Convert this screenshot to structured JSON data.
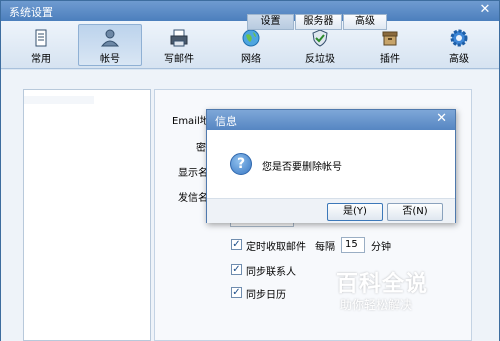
{
  "window": {
    "title": "系统设置",
    "close_glyph": "✕"
  },
  "toolbar": {
    "items": [
      {
        "label": "常用",
        "icon": "document-icon"
      },
      {
        "label": "帐号",
        "icon": "user-icon"
      },
      {
        "label": "写邮件",
        "icon": "printer-icon"
      },
      {
        "label": "网络",
        "icon": "globe-icon"
      },
      {
        "label": "反垃圾",
        "icon": "shield-icon"
      },
      {
        "label": "插件",
        "icon": "box-icon"
      },
      {
        "label": "高级",
        "icon": "gear-icon"
      }
    ],
    "active": "帐号"
  },
  "tabs": [
    "设置",
    "服务器",
    "高级"
  ],
  "form": {
    "labels": {
      "email": "Email地",
      "password": "密",
      "display_name": "显示名",
      "sender_name": "发信名"
    }
  },
  "options": {
    "fetch_label": "定时收取邮件",
    "interval_prefix": "每隔",
    "interval_value": "15",
    "interval_unit": "分钟",
    "sync_contacts_label": "同步联系人",
    "sync_calendar_label": "同步日历"
  },
  "dialog": {
    "title": "信息",
    "close_glyph": "✕",
    "icon_glyph": "?",
    "message": "您是否要删除帐号",
    "yes_label": "是(Y)",
    "no_label": "否(N)"
  },
  "watermark": {
    "title": "百科全说",
    "subtitle": "助你轻松解决"
  },
  "colors": {
    "titlebar": "#4c7fbd",
    "accent": "#3a78c3"
  }
}
